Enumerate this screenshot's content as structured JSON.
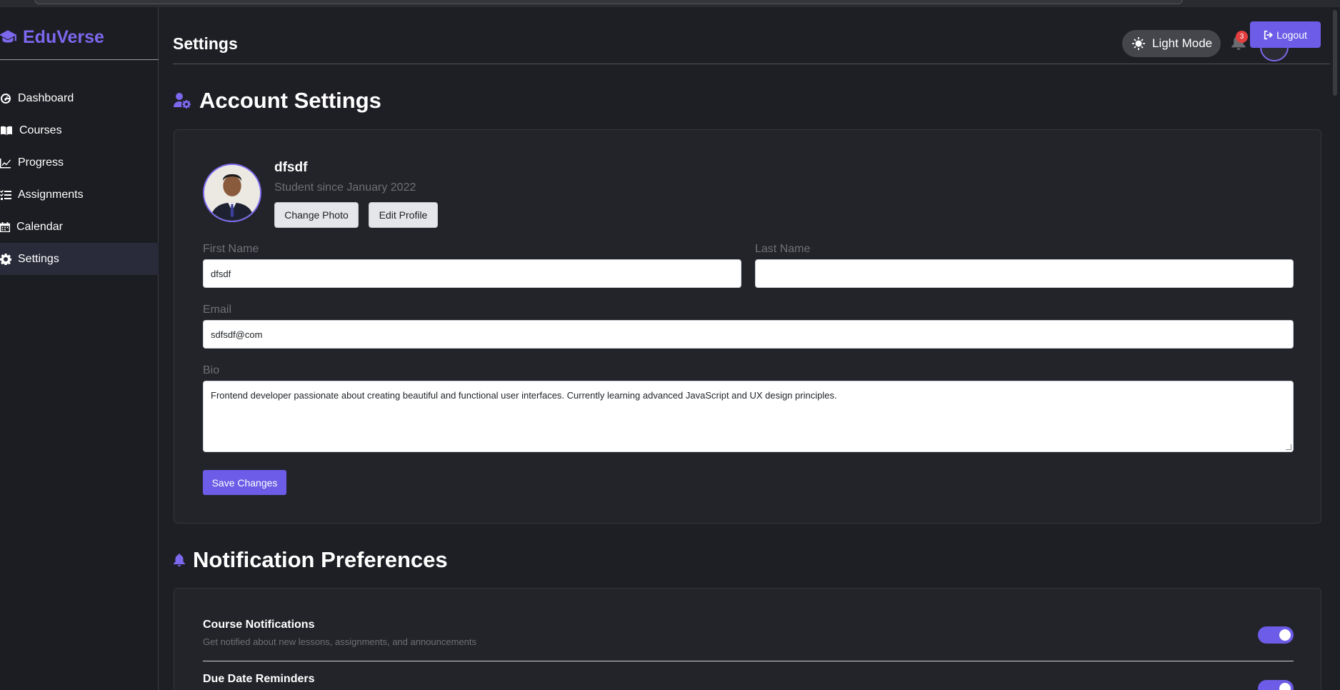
{
  "brand": {
    "name": "EduVerse"
  },
  "sidebar": {
    "items": [
      {
        "label": "Dashboard",
        "icon": "dashboard-icon"
      },
      {
        "label": "Courses",
        "icon": "book-icon"
      },
      {
        "label": "Progress",
        "icon": "chart-line-icon"
      },
      {
        "label": "Assignments",
        "icon": "tasks-icon"
      },
      {
        "label": "Calendar",
        "icon": "calendar-icon"
      },
      {
        "label": "Settings",
        "icon": "gear-icon",
        "active": true
      }
    ]
  },
  "header": {
    "title": "Settings",
    "mode_label": "Light Mode",
    "notification_count": "3",
    "logout_label": "Logout"
  },
  "account": {
    "section_title": "Account Settings",
    "profile_name": "dfsdf",
    "member_since": "Student since January 2022",
    "change_photo_label": "Change Photo",
    "edit_profile_label": "Edit Profile",
    "first_name_label": "First Name",
    "first_name_value": "dfsdf",
    "last_name_label": "Last Name",
    "last_name_value": "",
    "email_label": "Email",
    "email_value": "sdfsdf@com",
    "bio_label": "Bio",
    "bio_value": "Frontend developer passionate about creating beautiful and functional user interfaces. Currently learning advanced JavaScript and UX design principles.",
    "save_label": "Save Changes"
  },
  "notifications": {
    "section_title": "Notification Preferences",
    "items": [
      {
        "title": "Course Notifications",
        "description": "Get notified about new lessons, assignments, and announcements",
        "enabled": true
      },
      {
        "title": "Due Date Reminders",
        "description": "",
        "enabled": true
      }
    ]
  },
  "colors": {
    "accent": "#6c5ce7",
    "brand": "#7b68ee",
    "background": "#1e1f25",
    "card": "#23242a",
    "badge": "#e53e3e"
  }
}
